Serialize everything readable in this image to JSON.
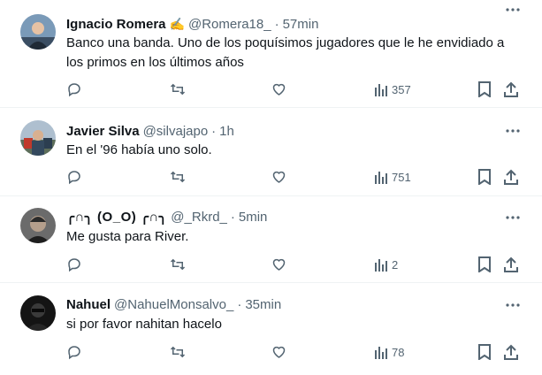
{
  "tweets": [
    {
      "name": "Ignacio Romera",
      "emoji": "✍️",
      "handle": "@Romera18_",
      "time": "57min",
      "lines": [
        "Banco una banda. Uno de los poquísimos jugadores que le he envidiado a",
        "los primos en los últimos años"
      ],
      "views": "357",
      "avatar_icon": "person-avatar-icon"
    },
    {
      "name": "Javier Silva",
      "handle": "@silvajapo",
      "time": "1h",
      "lines": [
        "En el '96 había uno solo."
      ],
      "views": "751",
      "avatar_icon": "person-avatar-icon"
    },
    {
      "name": "╭∩╮ (O_O) ╭∩╮",
      "handle": "@_Rkrd_",
      "time": "5min",
      "lines": [
        "Me gusta para River."
      ],
      "views": "2",
      "avatar_icon": "person-avatar-icon"
    },
    {
      "name": "Nahuel",
      "handle": "@NahuelMonsalvo_",
      "time": "35min",
      "lines": [
        "si por favor nahitan hacelo"
      ],
      "views": "78",
      "avatar_icon": "person-avatar-icon"
    }
  ],
  "separator": "·",
  "colors": {
    "text": "#0f1419",
    "muted": "#536471",
    "border": "#eff3f4"
  }
}
